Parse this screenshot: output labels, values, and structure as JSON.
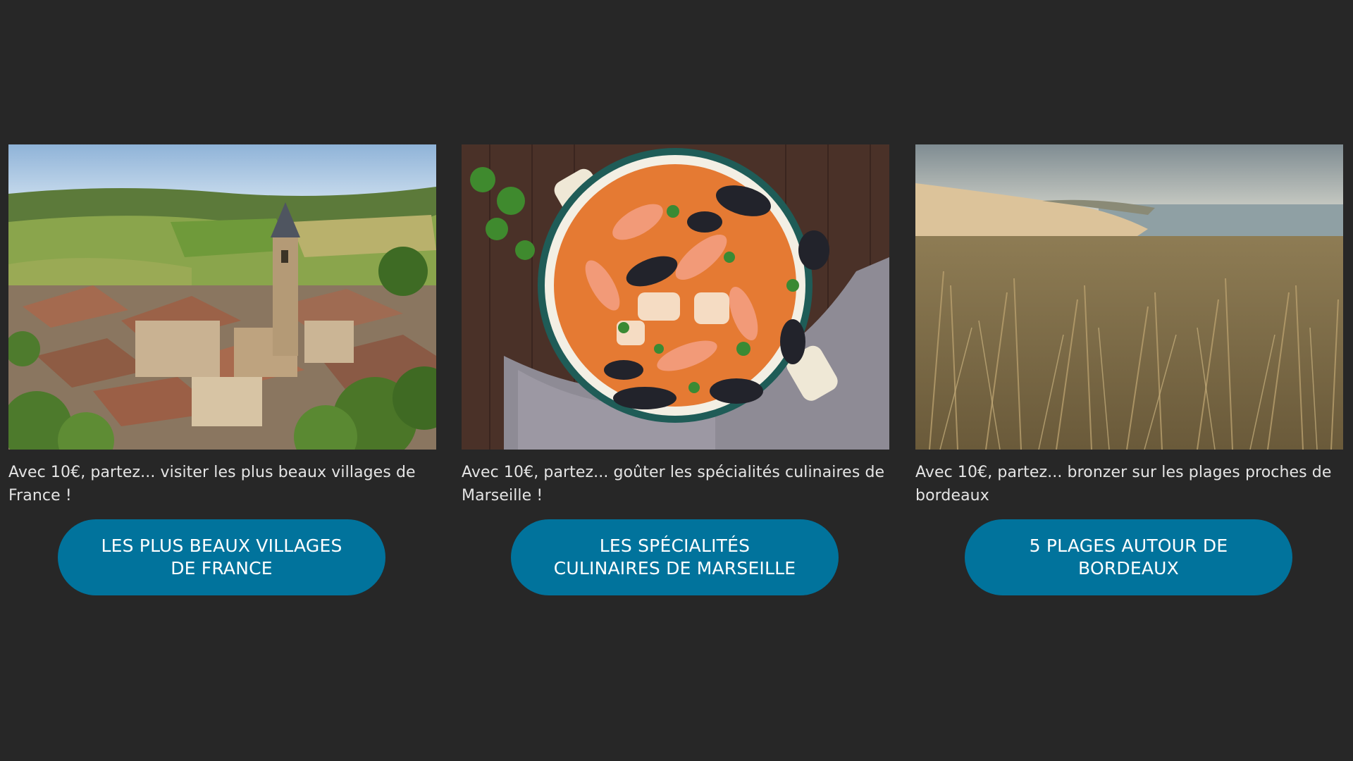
{
  "cards": [
    {
      "image_alt": "hilltop French village with church bell tower",
      "caption": "Avec 10€, partez... visiter les plus beaux villages de France !",
      "button_label": "LES PLUS BEAUX VILLAGES DE FRANCE"
    },
    {
      "image_alt": "bouillabaisse pot with shrimp and mussels",
      "caption": "Avec 10€, partez... goûter les spécialités culinaires de Marseille !",
      "button_label": "LES SPÉCIALITÉS CULINAIRES DE MARSEILLE"
    },
    {
      "image_alt": "coastal dune grass overlooking the sea",
      "caption": "Avec 10€, partez... bronzer sur les plages proches de bordeaux",
      "button_label": "5 PLAGES AUTOUR DE BORDEAUX"
    }
  ],
  "colors": {
    "background": "#272727",
    "button": "#01739c",
    "caption_text": "#e4e4e4",
    "button_text": "#ffffff"
  }
}
